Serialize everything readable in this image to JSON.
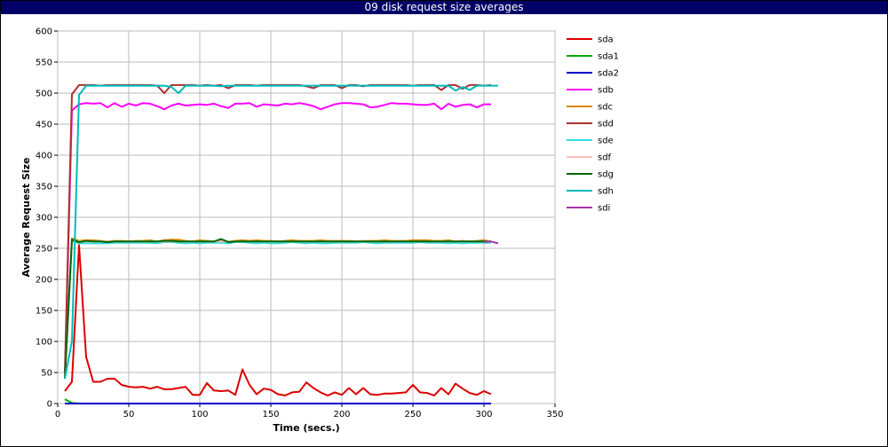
{
  "chart_data": {
    "type": "line",
    "title": "09 disk request size averages",
    "xlabel": "Time (secs.)",
    "ylabel": "Average Request Size",
    "xlim": [
      0,
      350
    ],
    "ylim": [
      0,
      600
    ],
    "x_ticks": [
      0,
      50,
      100,
      150,
      200,
      250,
      300,
      350
    ],
    "y_ticks": [
      0,
      50,
      100,
      150,
      200,
      250,
      300,
      350,
      400,
      450,
      500,
      550,
      600
    ],
    "grid": true,
    "legend_position": "right",
    "series": [
      {
        "name": "sda",
        "color": "#dd0000",
        "x": [
          5,
          10,
          15,
          20,
          25,
          30,
          35,
          40,
          45,
          50,
          55,
          60,
          65,
          70,
          75,
          80,
          85,
          90,
          95,
          100,
          105,
          110,
          115,
          120,
          125,
          130,
          135,
          140,
          145,
          150,
          155,
          160,
          165,
          170,
          175,
          180,
          185,
          190,
          195,
          200,
          205,
          210,
          215,
          220,
          225,
          230,
          235,
          240,
          245,
          250,
          255,
          260,
          265,
          270,
          275,
          280,
          285,
          290,
          295,
          300,
          305
        ],
        "y": [
          20,
          35,
          255,
          75,
          35,
          35,
          40,
          40,
          30,
          27,
          26,
          27,
          24,
          27,
          23,
          23,
          25,
          27,
          14,
          14,
          33,
          21,
          20,
          21,
          14,
          55,
          30,
          15,
          24,
          22,
          15,
          13,
          18,
          19,
          34,
          25,
          18,
          13,
          18,
          14,
          25,
          15,
          25,
          15,
          14,
          16,
          16,
          17,
          18,
          30,
          18,
          17,
          13,
          25,
          15,
          32,
          24,
          17,
          14,
          20,
          15
        ]
      },
      {
        "name": "sda1",
        "color": "#00aa00",
        "x": [
          5,
          10,
          15,
          305
        ],
        "y": [
          7,
          1,
          0,
          0
        ]
      },
      {
        "name": "sda2",
        "color": "#0000cc",
        "x": [
          5,
          10,
          15,
          305
        ],
        "y": [
          0,
          0,
          0,
          0
        ]
      },
      {
        "name": "sdb",
        "color": "#ff00ff",
        "x": [
          5,
          10,
          15,
          20,
          25,
          30,
          35,
          40,
          45,
          50,
          55,
          60,
          65,
          70,
          75,
          80,
          85,
          90,
          95,
          100,
          105,
          110,
          115,
          120,
          125,
          130,
          135,
          140,
          145,
          150,
          155,
          160,
          165,
          170,
          175,
          180,
          185,
          190,
          195,
          200,
          205,
          210,
          215,
          220,
          225,
          230,
          235,
          240,
          245,
          250,
          255,
          260,
          265,
          270,
          275,
          280,
          285,
          290,
          295,
          300,
          305
        ],
        "y": [
          40,
          472,
          482,
          484,
          483,
          484,
          477,
          484,
          478,
          483,
          480,
          484,
          483,
          479,
          474,
          480,
          483,
          480,
          481,
          482,
          481,
          483,
          479,
          476,
          483,
          483,
          484,
          478,
          482,
          481,
          480,
          483,
          482,
          484,
          482,
          479,
          474,
          478,
          482,
          484,
          484,
          483,
          482,
          477,
          478,
          481,
          484,
          483,
          483,
          482,
          481,
          481,
          483,
          474,
          483,
          478,
          481,
          482,
          477,
          482,
          482
        ]
      },
      {
        "name": "sdc",
        "color": "#dd8800",
        "x": [
          5,
          10,
          15,
          20,
          25,
          30,
          35,
          40,
          45,
          50,
          55,
          60,
          65,
          70,
          75,
          80,
          85,
          90,
          95,
          100,
          105,
          110,
          115,
          120,
          125,
          130,
          135,
          140,
          145,
          150,
          155,
          160,
          165,
          170,
          175,
          180,
          185,
          190,
          195,
          200,
          205,
          210,
          215,
          220,
          225,
          230,
          235,
          240,
          245,
          250,
          255,
          260,
          265,
          270,
          275,
          280,
          285,
          290,
          295,
          300,
          305
        ],
        "y": [
          40,
          266,
          262,
          263,
          263,
          262,
          261,
          262,
          262,
          261,
          262,
          262,
          263,
          261,
          263,
          264,
          264,
          262,
          261,
          263,
          262,
          261,
          263,
          261,
          262,
          263,
          262,
          263,
          262,
          262,
          261,
          262,
          263,
          262,
          262,
          262,
          263,
          262,
          262,
          262,
          262,
          261,
          262,
          262,
          262,
          263,
          262,
          262,
          262,
          263,
          263,
          263,
          262,
          262,
          263,
          261,
          262,
          261,
          262,
          263,
          261
        ]
      },
      {
        "name": "sdd",
        "color": "#aa3333",
        "x": [
          5,
          10,
          15,
          20,
          25,
          30,
          35,
          40,
          45,
          50,
          55,
          60,
          65,
          70,
          75,
          80,
          85,
          90,
          95,
          100,
          105,
          110,
          115,
          120,
          125,
          130,
          135,
          140,
          145,
          150,
          155,
          160,
          165,
          170,
          175,
          180,
          185,
          190,
          195,
          200,
          205,
          210,
          215,
          220,
          225,
          230,
          235,
          240,
          245,
          250,
          255,
          260,
          265,
          270,
          275,
          280,
          285,
          290,
          295,
          300,
          305
        ],
        "y": [
          50,
          498,
          513,
          513,
          513,
          512,
          513,
          513,
          513,
          513,
          513,
          513,
          513,
          512,
          500,
          513,
          513,
          513,
          513,
          512,
          513,
          512,
          513,
          508,
          513,
          513,
          513,
          512,
          513,
          513,
          513,
          513,
          513,
          513,
          511,
          508,
          513,
          513,
          513,
          508,
          513,
          513,
          511,
          513,
          513,
          513,
          513,
          513,
          513,
          512,
          513,
          513,
          513,
          505,
          513,
          513,
          507,
          513,
          513,
          512,
          513
        ]
      },
      {
        "name": "sde",
        "color": "#33dddd",
        "x": [
          5,
          10,
          15,
          20,
          25,
          30,
          35,
          40,
          45,
          50,
          55,
          60,
          65,
          70,
          75,
          80,
          85,
          90,
          95,
          100,
          105,
          110,
          115,
          120,
          125,
          130,
          135,
          140,
          145,
          150,
          155,
          160,
          165,
          170,
          175,
          180,
          185,
          190,
          195,
          200,
          205,
          210,
          215,
          220,
          225,
          230,
          235,
          240,
          245,
          250,
          255,
          260,
          265,
          270,
          275,
          280,
          285,
          290,
          295,
          300,
          305
        ],
        "y": [
          40,
          262,
          258,
          258,
          258,
          258,
          258,
          259,
          259,
          259,
          259,
          259,
          259,
          258,
          260,
          260,
          259,
          258,
          259,
          258,
          259,
          259,
          259,
          258,
          260,
          260,
          259,
          258,
          259,
          258,
          258,
          259,
          260,
          259,
          258,
          259,
          258,
          258,
          259,
          259,
          259,
          259,
          260,
          259,
          258,
          259,
          259,
          259,
          259,
          259,
          260,
          259,
          259,
          259,
          258,
          259,
          258,
          259,
          259,
          259,
          259
        ]
      },
      {
        "name": "sdf",
        "color": "#ffbbbb",
        "x": [
          5,
          10,
          15,
          20,
          25,
          30,
          35,
          40,
          45,
          50,
          55,
          60,
          65,
          70,
          75,
          80,
          85,
          90,
          95,
          100,
          105,
          110,
          115,
          120,
          125,
          130,
          135,
          140,
          145,
          150,
          155,
          160,
          165,
          170,
          175,
          180,
          185,
          190,
          195,
          200,
          205,
          210,
          215,
          220,
          225,
          230,
          235,
          240,
          245,
          250,
          255,
          260,
          265,
          270,
          275,
          280,
          285,
          290,
          295,
          300,
          305
        ],
        "y": [
          40,
          260,
          261,
          261,
          261,
          261,
          261,
          261,
          261,
          261,
          261,
          261,
          261,
          261,
          261,
          261,
          261,
          261,
          261,
          261,
          261,
          261,
          261,
          261,
          261,
          261,
          261,
          261,
          261,
          261,
          261,
          261,
          261,
          261,
          261,
          261,
          261,
          261,
          261,
          261,
          261,
          261,
          261,
          261,
          261,
          261,
          261,
          261,
          261,
          261,
          261,
          261,
          261,
          261,
          261,
          261,
          261,
          261,
          261,
          261,
          261
        ]
      },
      {
        "name": "sdg",
        "color": "#006600",
        "x": [
          5,
          10,
          15,
          20,
          25,
          30,
          35,
          40,
          45,
          50,
          55,
          60,
          65,
          70,
          75,
          80,
          85,
          90,
          95,
          100,
          105,
          110,
          115,
          120,
          125,
          130,
          135,
          140,
          145,
          150,
          155,
          160,
          165,
          170,
          175,
          180,
          185,
          190,
          195,
          200,
          205,
          210,
          215,
          220,
          225,
          230,
          235,
          240,
          245,
          250,
          255,
          260,
          265,
          270,
          275,
          280,
          285,
          290,
          295,
          300,
          305
        ],
        "y": [
          40,
          264,
          260,
          262,
          261,
          261,
          260,
          261,
          261,
          261,
          261,
          261,
          261,
          261,
          262,
          262,
          261,
          261,
          261,
          261,
          261,
          261,
          265,
          260,
          261,
          261,
          261,
          261,
          261,
          261,
          261,
          261,
          261,
          261,
          261,
          261,
          261,
          261,
          261,
          261,
          261,
          261,
          261,
          261,
          261,
          261,
          261,
          261,
          261,
          261,
          261,
          261,
          261,
          261,
          261,
          261,
          261,
          261,
          261,
          261,
          261
        ]
      },
      {
        "name": "sdh",
        "color": "#00bbbb",
        "x": [
          5,
          10,
          15,
          20,
          25,
          30,
          35,
          40,
          45,
          50,
          55,
          60,
          65,
          70,
          75,
          80,
          85,
          90,
          95,
          100,
          105,
          110,
          115,
          120,
          125,
          130,
          135,
          140,
          145,
          150,
          155,
          160,
          165,
          170,
          175,
          180,
          185,
          190,
          195,
          200,
          205,
          210,
          215,
          220,
          225,
          230,
          235,
          240,
          245,
          250,
          255,
          260,
          265,
          270,
          275,
          280,
          285,
          290,
          295,
          300,
          305,
          310
        ],
        "y": [
          40,
          100,
          497,
          512,
          512,
          512,
          512,
          512,
          512,
          512,
          512,
          512,
          512,
          512,
          512,
          510,
          500,
          512,
          512,
          512,
          512,
          512,
          511,
          512,
          512,
          512,
          512,
          512,
          512,
          512,
          512,
          512,
          512,
          512,
          512,
          512,
          512,
          512,
          512,
          512,
          512,
          512,
          512,
          512,
          512,
          512,
          512,
          512,
          512,
          512,
          512,
          512,
          512,
          512,
          512,
          504,
          510,
          505,
          512,
          512,
          512,
          512
        ]
      },
      {
        "name": "sdi",
        "color": "#aa33aa",
        "x": [
          300,
          305,
          310
        ],
        "y": [
          260,
          261,
          258
        ]
      }
    ]
  }
}
